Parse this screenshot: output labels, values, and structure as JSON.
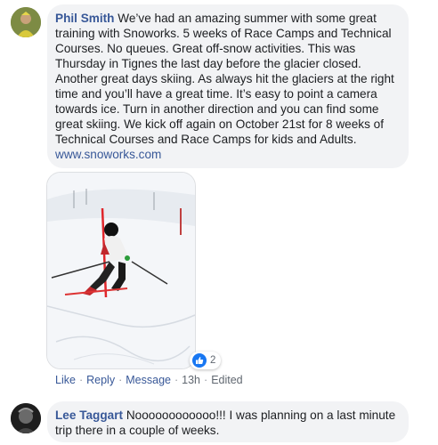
{
  "comment1": {
    "author": "Phil Smith",
    "text": "We’ve had an amazing summer with some great training with Snoworks. 5 weeks of Race Camps and Technical Courses. No queues. Great off-snow activities. This was Thursday in Tignes the last day before the glacier closed. Another great days skiing. As always hit the glaciers at the right time and you’ll have a great time. It’s easy to point a camera towards ice. Turn in another direction and you can find some great skiing. We kick off again on October 21st for 8 weeks of Technical Courses and Race Camps for kids and Adults.",
    "link": "www.snoworks.com",
    "reaction_count": "2",
    "actions": {
      "like": "Like",
      "reply": "Reply",
      "message": "Message",
      "time": "13h",
      "edited": "Edited",
      "separator": "·"
    }
  },
  "comment2": {
    "author": "Lee Taggart",
    "text": "Noooooooooooo!!! I was planning on a last minute trip there in a couple of weeks."
  },
  "colors": {
    "author": "#385898",
    "bubble": "#f2f3f5",
    "like_blue": "#1877f2",
    "meta": "#606770"
  },
  "icons": {
    "reaction": "thumbs-up-icon"
  }
}
